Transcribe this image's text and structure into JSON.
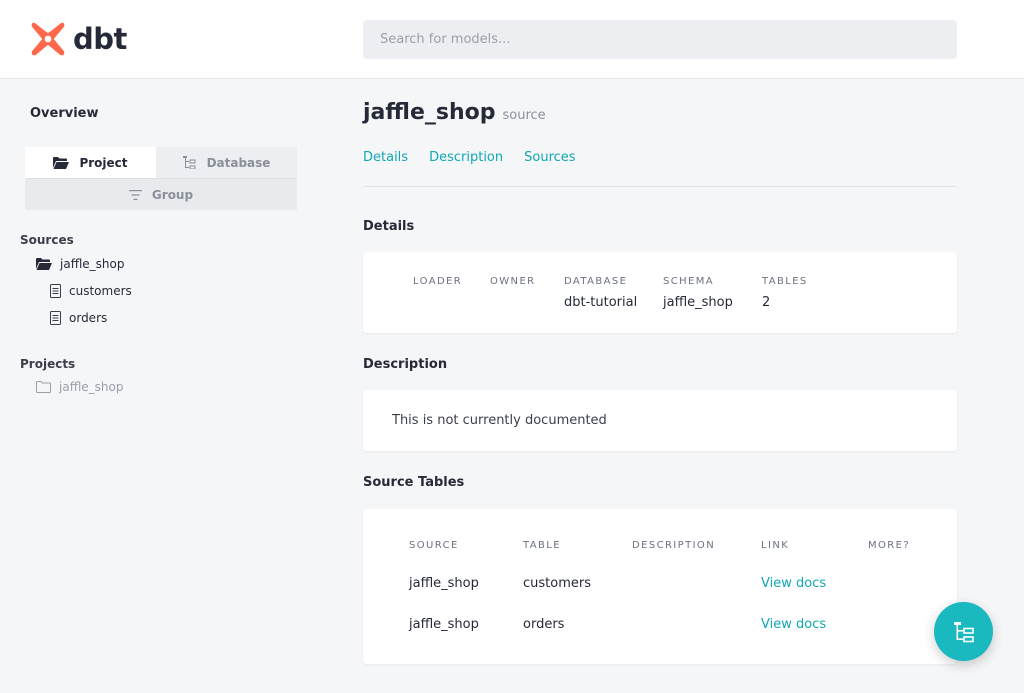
{
  "header": {
    "logo_text": "dbt",
    "search_placeholder": "Search for models...",
    "brand_color": "#ff694b"
  },
  "sidebar": {
    "overview_label": "Overview",
    "tabs": {
      "project": "Project",
      "database": "Database",
      "group": "Group"
    },
    "sources_label": "Sources",
    "source_root": "jaffle_shop",
    "source_children": [
      "customers",
      "orders"
    ],
    "projects_label": "Projects",
    "project_root": "jaffle_shop"
  },
  "main": {
    "title": "jaffle_shop",
    "subtitle": "source",
    "anchors": [
      "Details",
      "Description",
      "Sources"
    ],
    "details": {
      "heading": "Details",
      "fields": [
        {
          "key": "LOADER",
          "value": ""
        },
        {
          "key": "OWNER",
          "value": ""
        },
        {
          "key": "DATABASE",
          "value": "dbt-tutorial"
        },
        {
          "key": "SCHEMA",
          "value": "jaffle_shop"
        },
        {
          "key": "TABLES",
          "value": "2"
        }
      ]
    },
    "description": {
      "heading": "Description",
      "text": "This is not currently documented"
    },
    "source_tables": {
      "heading": "Source Tables",
      "columns": [
        "SOURCE",
        "TABLE",
        "DESCRIPTION",
        "LINK",
        "MORE?"
      ],
      "rows": [
        {
          "source": "jaffle_shop",
          "table": "customers",
          "description": "",
          "link": "View docs"
        },
        {
          "source": "jaffle_shop",
          "table": "orders",
          "description": "",
          "link": "View docs"
        }
      ]
    }
  },
  "colors": {
    "accent": "#10a8b2",
    "fab": "#1ab8bf"
  },
  "fab_icon": "lineage-graph-icon"
}
